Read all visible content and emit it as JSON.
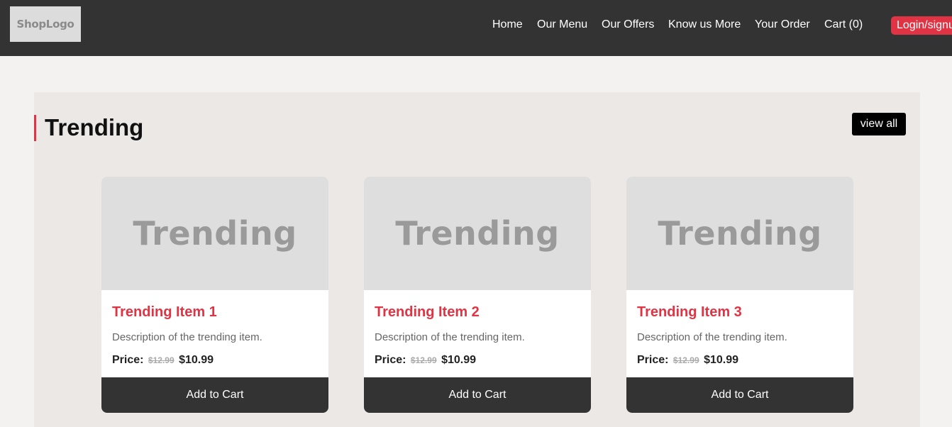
{
  "header": {
    "logo": "ShopLogo",
    "nav": [
      {
        "label": "Home"
      },
      {
        "label": "Our Menu"
      },
      {
        "label": "Our Offers"
      },
      {
        "label": "Know us More"
      },
      {
        "label": "Your Order"
      },
      {
        "label": "Cart (0)"
      }
    ],
    "login_label": "Login/signup"
  },
  "section": {
    "title": "Trending",
    "view_all_label": "view all",
    "cards": [
      {
        "image_text": "Trending",
        "title": "Trending Item 1",
        "description": "Description of the trending item.",
        "price_label": "Price:",
        "old_price": "$12.99",
        "new_price": "$10.99",
        "button_label": "Add to Cart"
      },
      {
        "image_text": "Trending",
        "title": "Trending Item 2",
        "description": "Description of the trending item.",
        "price_label": "Price:",
        "old_price": "$12.99",
        "new_price": "$10.99",
        "button_label": "Add to Cart"
      },
      {
        "image_text": "Trending",
        "title": "Trending Item 3",
        "description": "Description of the trending item.",
        "price_label": "Price:",
        "old_price": "$12.99",
        "new_price": "$10.99",
        "button_label": "Add to Cart"
      }
    ]
  },
  "colors": {
    "accent": "#e03444",
    "navbar": "#333333",
    "page_background": "#f3f2f0",
    "section_background": "#ece8e6"
  }
}
